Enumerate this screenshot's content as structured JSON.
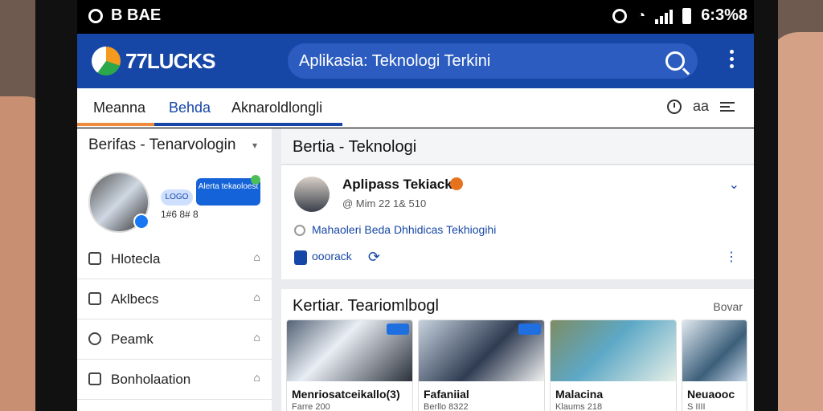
{
  "status_bar": {
    "left_text": "B BAE",
    "time": "6:3%8"
  },
  "app": {
    "brand": "77LUCKS",
    "search_text": "Aplikasia: Teknologi Terkini"
  },
  "tabs": [
    {
      "label": "Meanna"
    },
    {
      "label": "Behda"
    },
    {
      "label": "Aknaroldlongli"
    }
  ],
  "tab_tools": {
    "label": "aa"
  },
  "sidebar": {
    "title": "Berifas - Tenarvologin",
    "mini_badge": "LOGO",
    "promo_text": "Alerta tekaoloest",
    "stats": "1#6 8# 8",
    "items": [
      {
        "label": "Hlotecla"
      },
      {
        "label": "Aklbecs"
      },
      {
        "label": "Peamk"
      },
      {
        "label": "Bonholaation"
      }
    ]
  },
  "news": {
    "header": "Bertia - Teknologi",
    "post": {
      "title": "Aplipass Tekiack",
      "meta": "@ Mim 22 1& 510",
      "link": "Mahaoleri Beda Dhhidicas Tekhiogihi",
      "action": "ooorack"
    },
    "tech": {
      "title": "Kertiar. Teariomlbogl",
      "more": "Bovar",
      "cards": [
        {
          "title": "Menriosatceikallo(3)",
          "subtitle": "Farre 200"
        },
        {
          "title": "Fafaniial",
          "subtitle": "Berllo 8322"
        },
        {
          "title": "Malacina",
          "subtitle": "Klaums 218"
        },
        {
          "title": "Neuaooc",
          "subtitle": "S IIII"
        }
      ]
    }
  }
}
